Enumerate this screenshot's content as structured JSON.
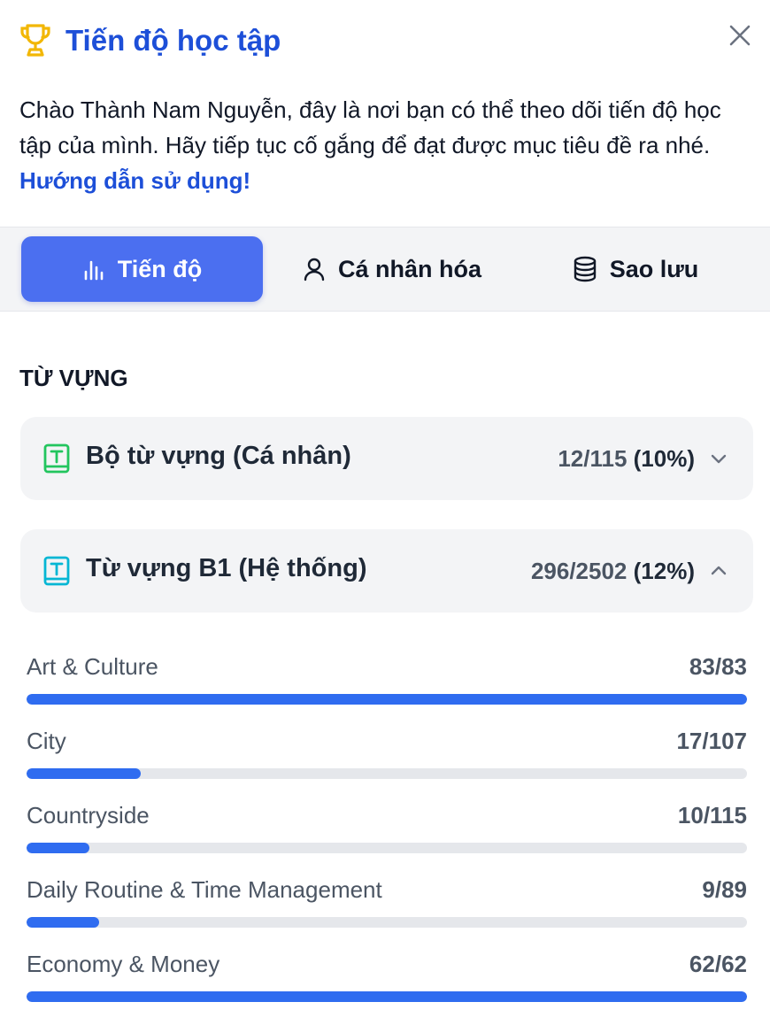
{
  "header": {
    "title": "Tiến độ học tập",
    "trophy_icon": "trophy-icon",
    "close_icon": "close-icon",
    "description": "Chào Thành Nam Nguyễn, đây là nơi bạn có thể theo dõi tiến độ học tập của mình. Hãy tiếp tục cố gắng để đạt được mục tiêu đề ra nhé.",
    "guide_link": "Hướng dẫn sử dụng!"
  },
  "tabs": [
    {
      "label": "Tiến độ",
      "icon": "bar-chart-icon",
      "active": true
    },
    {
      "label": "Cá nhân hóa",
      "icon": "user-icon",
      "active": false
    },
    {
      "label": "Sao lưu",
      "icon": "database-icon",
      "active": false
    }
  ],
  "section": {
    "label": "TỪ VỰNG"
  },
  "decks": [
    {
      "title": "Bộ từ vựng (Cá nhân)",
      "count": "12/115",
      "percent": "(10%)",
      "expanded": false,
      "icon_color": "#22c55e"
    },
    {
      "title": "Từ vựng B1 (Hệ thống)",
      "count": "296/2502",
      "percent": "(12%)",
      "expanded": true,
      "icon_color": "#06b6d4"
    }
  ],
  "topics": [
    {
      "name": "Art & Culture",
      "count": "83/83",
      "progress": 1.0
    },
    {
      "name": "City",
      "count": "17/107",
      "progress": 0.159
    },
    {
      "name": "Countryside",
      "count": "10/115",
      "progress": 0.087
    },
    {
      "name": "Daily Routine & Time Management",
      "count": "9/89",
      "progress": 0.101
    },
    {
      "name": "Economy & Money",
      "count": "62/62",
      "progress": 1.0
    }
  ],
  "colors": {
    "accent": "#4b6ff0",
    "title_blue": "#1d4fd8",
    "progress_fill": "#2f6cf0",
    "trophy": "#f2b705"
  }
}
